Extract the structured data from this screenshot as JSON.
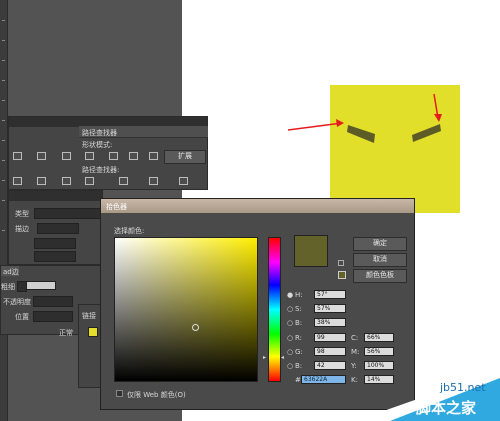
{
  "pathfinder": {
    "title": "路径查找器",
    "shape_modes_label": "形状模式:",
    "expand_label": "扩展",
    "pathfinder_label": "路径查找器:"
  },
  "properties": {
    "type_label": "类型",
    "stroke_label": "描边",
    "weight_label": "粗细",
    "opacity_label": "不透明度",
    "position_label": "位置",
    "gradient_tab": "ad边",
    "normal_label": "正常",
    "links_tab": "链接"
  },
  "picker": {
    "title": "拾色器",
    "select_color_label": "选择颜色:",
    "ok": "确定",
    "cancel": "取消",
    "swatches": "颜色色板",
    "web_only": "仅限 Web 颜色(O)",
    "current_color": "#63622A",
    "fields": {
      "H_label": "H:",
      "H_value": "57°",
      "S_label": "S:",
      "S_value": "57%",
      "B_label": "B:",
      "B_value": "38%",
      "R_label": "R:",
      "R_value": "99",
      "G_label": "G:",
      "G_value": "98",
      "Bl_label": "B:",
      "Bl_value": "42",
      "C_label": "C:",
      "C_value": "66%",
      "M_label": "M:",
      "M_value": "56%",
      "Y_label": "Y:",
      "Y_value": "100%",
      "K_label": "K:",
      "K_value": "14%",
      "hex_label": "#",
      "hex_value": "63622A"
    }
  },
  "colors": {
    "yellow_box": "#e2df2b",
    "eye": "#5d5c26",
    "arrow": "#e51c1c"
  },
  "watermark": {
    "site": "jb51.net",
    "name": "脚本之家"
  }
}
